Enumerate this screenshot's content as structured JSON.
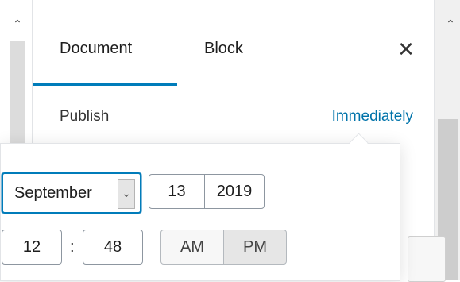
{
  "scrollbars": {
    "left_arrow_icon": "chevron-up-icon",
    "right_arrow_icon": "chevron-up-icon"
  },
  "sidebar": {
    "tabs": [
      {
        "label": "Document",
        "active": true
      },
      {
        "label": "Block",
        "active": false
      }
    ],
    "close_icon": "close-icon"
  },
  "publish": {
    "label": "Publish",
    "value": "Immediately"
  },
  "datetime": {
    "month": "September",
    "day": "13",
    "year": "2019",
    "hour": "12",
    "separator": ":",
    "minute": "48",
    "am_label": "AM",
    "pm_label": "PM",
    "selected_meridian": "PM"
  },
  "colors": {
    "accent": "#007cba",
    "link": "#0073aa"
  }
}
